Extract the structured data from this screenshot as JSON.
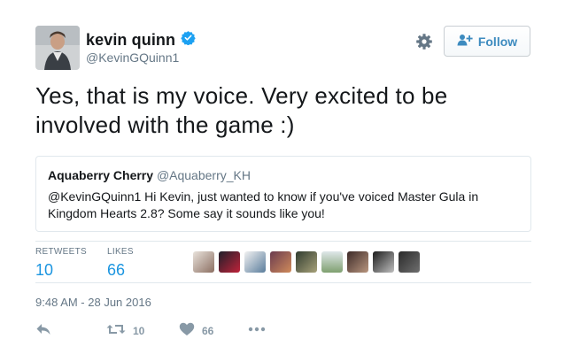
{
  "author": {
    "name": "kevin quinn",
    "handle": "@KevinGQuinn1",
    "verified": true
  },
  "follow_button": {
    "label": "Follow"
  },
  "tweet": {
    "text": "Yes, that is my voice. Very excited to be involved with the game :)"
  },
  "quoted_tweet": {
    "name": "Aquaberry Cherry",
    "handle": "@Aquaberry_KH",
    "text": "@KevinGQuinn1 Hi Kevin, just wanted to know if you've voiced Master Gula in Kingdom Hearts 2.8? Some say it sounds like you!"
  },
  "stats": {
    "retweets_label": "RETWEETS",
    "retweets": "10",
    "likes_label": "LIKES",
    "likes": "66"
  },
  "timestamp": "9:48 AM - 28 Jun 2016",
  "actions": {
    "retweet_count": "10",
    "like_count": "66"
  },
  "colors": {
    "link_blue": "#1b95e0",
    "verified_blue": "#1da1f2",
    "muted": "#657786",
    "border": "#e1e8ed"
  },
  "liker_avatars": [
    "liker-avatar-1",
    "liker-avatar-2",
    "liker-avatar-3",
    "liker-avatar-4",
    "liker-avatar-5",
    "liker-avatar-6",
    "liker-avatar-7",
    "liker-avatar-8",
    "liker-avatar-9"
  ]
}
